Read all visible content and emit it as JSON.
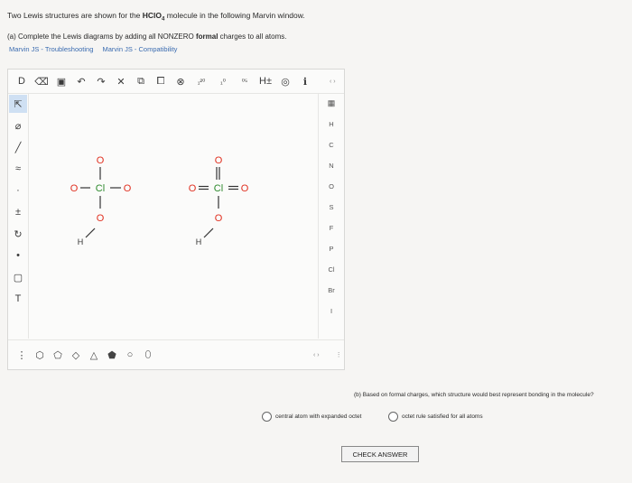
{
  "intro": {
    "prefix": "Two Lewis structures are shown for the ",
    "molecule": "HClO",
    "subscript": "4",
    "suffix": " molecule in the following Marvin window."
  },
  "part_a": {
    "prefix": "(a) Complete the Lewis diagrams by adding all NONZERO ",
    "bold": "formal",
    "suffix": " charges to all atoms."
  },
  "links": [
    "Marvin JS - Troubleshooting",
    "Marvin JS - Compatibility"
  ],
  "toolbar_icons": [
    "D",
    "⌫",
    "▣",
    "↶",
    "↷",
    "✕",
    "⧉",
    "⧠",
    "⊗",
    "₁²⁰",
    "₁⁰",
    "⁰⁵",
    "H±",
    "◎",
    "ℹ"
  ],
  "left_tools": [
    "⇱",
    "⌀",
    "╱",
    "≈",
    "·",
    "±",
    "↻",
    "•",
    "▢",
    "T"
  ],
  "elements": [
    "H",
    "C",
    "N",
    "O",
    "S",
    "F",
    "P",
    "Cl",
    "Br",
    "I"
  ],
  "bottom_icons": [
    "⋮",
    "⬡",
    "⬠",
    "◇",
    "△",
    "⬟",
    "○",
    "⬯"
  ],
  "scroll_arrows": {
    "top": "‹ ›",
    "bottom": "‹ ›",
    "side": "⋮"
  },
  "molecules": {
    "m1": {
      "top_o": "O",
      "left_o": "O",
      "cl": "Cl",
      "right_o": "O",
      "bottom_o": "O",
      "h": "H"
    },
    "m2": {
      "top_o": "O",
      "left_o": "O",
      "cl": "Cl",
      "right_o": "O",
      "bottom_o": "O",
      "h": "H"
    }
  },
  "part_b": {
    "question": "(b) Based on formal charges, which structure would best represent bonding in the molecule?",
    "option1": "central atom with expanded octet",
    "option2": "octet rule satisfied for all atoms"
  },
  "check_answer": "CHECK ANSWER",
  "colors": {
    "oxygen": "#e03020",
    "chlorine": "#2c8a2c",
    "link": "#3a6bb0"
  }
}
